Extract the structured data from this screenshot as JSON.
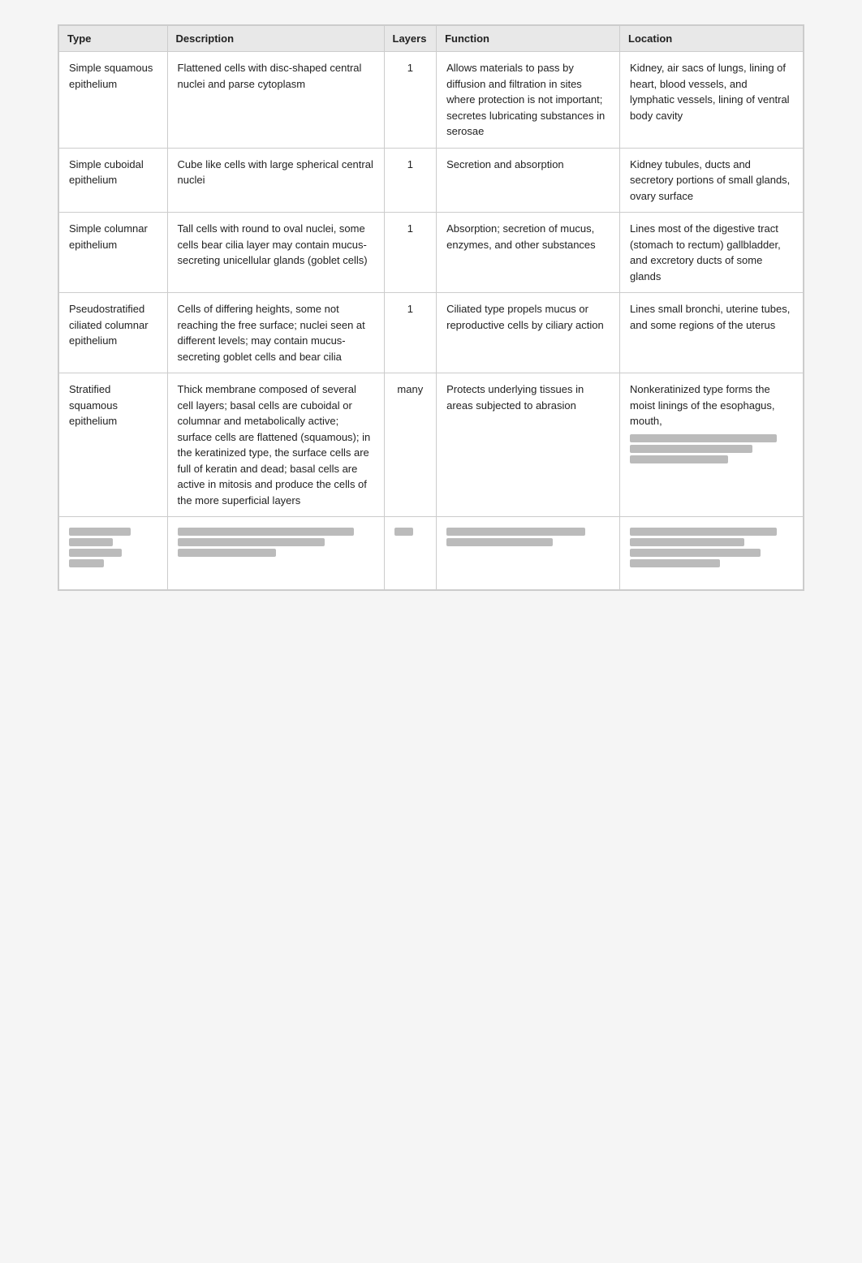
{
  "table": {
    "headers": [
      "Type",
      "Description",
      "Layers",
      "Function",
      "Location"
    ],
    "rows": [
      {
        "type": "Simple squamous epithelium",
        "description": "Flattened cells with disc-shaped central nuclei and parse cytoplasm",
        "layers": "1",
        "function": "Allows materials to pass by diffusion and filtration in sites where protection is not important; secretes lubricating substances in serosae",
        "location": "Kidney, air sacs of lungs, lining of heart, blood vessels, and lymphatic vessels, lining of ventral body cavity"
      },
      {
        "type": "Simple cuboidal epithelium",
        "description": "Cube like cells with large spherical central nuclei",
        "layers": "1",
        "function": "Secretion and absorption",
        "location": "Kidney tubules, ducts and secretory portions of small glands, ovary surface"
      },
      {
        "type": "Simple columnar epithelium",
        "description": "Tall cells with round to oval nuclei, some cells bear cilia layer may contain mucus-secreting unicellular glands (goblet cells)",
        "layers": "1",
        "function": "Absorption; secretion of mucus, enzymes, and other substances",
        "location": "Lines most of the digestive tract (stomach to rectum) gallbladder, and excretory ducts of some glands"
      },
      {
        "type": "Pseudostratified ciliated columnar epithelium",
        "description": "Cells of differing heights, some not reaching the free surface; nuclei seen at different levels; may contain mucus-secreting goblet cells and bear cilia",
        "layers": "1",
        "function": "Ciliated type propels mucus or reproductive cells by ciliary action",
        "location": "Lines small bronchi, uterine tubes, and some regions of the uterus"
      },
      {
        "type": "Stratified squamous epithelium",
        "description": "Thick membrane composed of several cell layers; basal cells are cuboidal or columnar and metabolically active; surface cells are flattened (squamous); in the keratinized type, the surface cells are full of keratin and dead; basal cells are active in mitosis and produce the cells of the more superficial layers",
        "layers": "many",
        "function": "Protects underlying tissues in areas subjected to abrasion",
        "location": "Nonkeratinized type forms the moist linings of the esophagus, mouth,"
      },
      {
        "type": "blurred",
        "description": "blurred",
        "layers": "blurred",
        "function": "blurred",
        "location": "blurred"
      }
    ]
  }
}
